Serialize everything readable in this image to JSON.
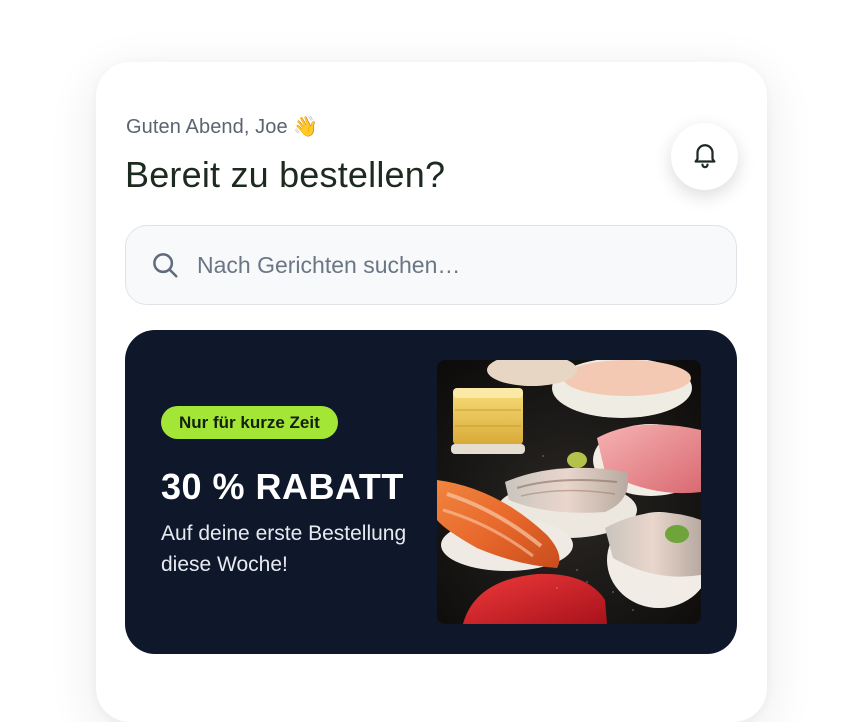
{
  "header": {
    "greeting": "Guten Abend, Joe",
    "greeting_emoji": "👋",
    "title": "Bereit zu bestellen?",
    "notification_icon": "bell-icon"
  },
  "search": {
    "placeholder": "Nach Gerichten suchen…",
    "value": "",
    "icon": "search-icon"
  },
  "promo": {
    "badge": "Nur für kurze Zeit",
    "headline": "30 % RABATT",
    "subtitle": "Auf deine erste Bestellung diese Woche!",
    "image_subject": "sushi-nigiri-platter"
  },
  "colors": {
    "promo_background": "#0f172a",
    "badge_background": "#a3e635",
    "heading_text": "#1c2a20"
  }
}
